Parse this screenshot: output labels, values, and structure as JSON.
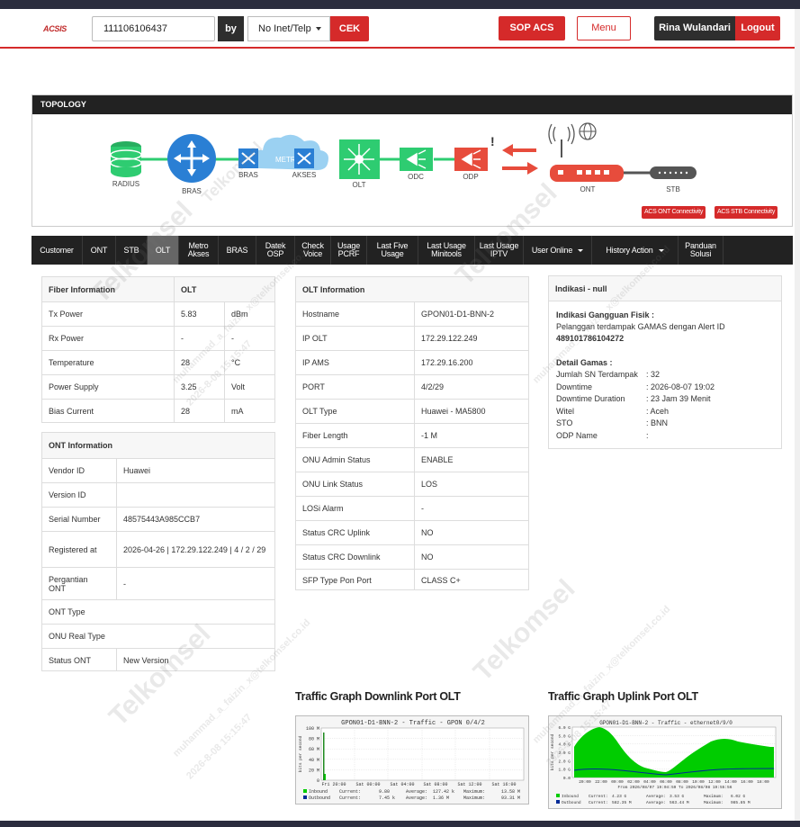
{
  "app": {
    "logo": "ACSIS",
    "search_value": "111106106437",
    "by_label": "by",
    "search_type": "No Inet/Telp",
    "check_label": "CEK",
    "sop_label": "SOP ACS",
    "menu_label": "Menu",
    "user_name": "Rina Wulandari",
    "logout_label": "Logout"
  },
  "topology": {
    "title": "TOPOLOGY",
    "nodes": {
      "radius": "RADIUS",
      "bras1": "BRAS",
      "bras2": "BRAS",
      "metro": "METRO - E",
      "akses": "AKSES",
      "olt": "OLT",
      "odc": "ODC",
      "odp": "ODP",
      "ont": "ONT",
      "stb": "STB"
    },
    "acs_ont_button": "ACS ONT Connectivity",
    "acs_stb_button": "ACS STB Connectivity",
    "colors": {
      "green": "#2ecc71",
      "blue": "#2a7fd4",
      "red": "#e74c3c",
      "dark": "#555555"
    }
  },
  "tabs": [
    {
      "label": "Customer"
    },
    {
      "label": "ONT"
    },
    {
      "label": "STB"
    },
    {
      "label": "OLT",
      "active": true
    },
    {
      "label": "Metro Akses"
    },
    {
      "label": "BRAS"
    },
    {
      "label": "Datek OSP"
    },
    {
      "label": "Check Voice"
    },
    {
      "label": "Usage PCRF"
    },
    {
      "label": "Last Five Usage"
    },
    {
      "label": "Last Usage Minitools"
    },
    {
      "label": "Last Usage IPTV"
    },
    {
      "label": "User Online",
      "dropdown": true
    },
    {
      "label": "History Action",
      "dropdown": true
    },
    {
      "label": "Panduan Solusi"
    }
  ],
  "fiber": {
    "header": [
      "Fiber Information",
      "OLT"
    ],
    "rows": [
      [
        "Tx Power",
        "5.83",
        "dBm"
      ],
      [
        "Rx Power",
        "-",
        "-"
      ],
      [
        "Temperature",
        "28",
        "°C"
      ],
      [
        "Power Supply",
        "3.25",
        "Volt"
      ],
      [
        "Bias Current",
        "28",
        "mA"
      ]
    ]
  },
  "ont_info": {
    "header": "ONT Information",
    "rows": [
      [
        "Vendor ID",
        "Huawei"
      ],
      [
        "Version ID",
        ""
      ],
      [
        "Serial Number",
        "48575443A985CCB7"
      ],
      [
        "Registered at",
        "2026-04-26 | 172.29.122.249 | 4 / 2 / 29"
      ],
      [
        "Pergantian ONT",
        "-"
      ],
      [
        "ONT Type",
        ""
      ],
      [
        "ONU Real Type",
        ""
      ],
      [
        "Status ONT",
        "New Version"
      ]
    ]
  },
  "olt_info": {
    "header": "OLT Information",
    "rows": [
      [
        "Hostname",
        "GPON01-D1-BNN-2"
      ],
      [
        "IP OLT",
        "172.29.122.249"
      ],
      [
        "IP AMS",
        "172.29.16.200"
      ],
      [
        "PORT",
        "4/2/29"
      ],
      [
        "OLT Type",
        "Huawei - MA5800"
      ],
      [
        "Fiber Length",
        "-1 M"
      ],
      [
        "ONU Admin Status",
        "ENABLE"
      ],
      [
        "ONU Link Status",
        "LOS"
      ],
      [
        "LOSi Alarm",
        "-"
      ],
      [
        "Status CRC Uplink",
        "NO"
      ],
      [
        "Status CRC Downlink",
        "NO"
      ],
      [
        "SFP Type Pon Port",
        "CLASS C+"
      ]
    ]
  },
  "indikasi": {
    "header": "Indikasi - null",
    "gangguan_title": "Indikasi Gangguan Fisik :",
    "gangguan_text": "Pelanggan terdampak GAMAS dengan Alert ID",
    "alert_id": "489101786104272",
    "detail_title": "Detail Gamas :",
    "rows": [
      [
        "Jumlah SN Terdampak",
        ": 32"
      ],
      [
        "Downtime",
        ": 2026-08-07 19:02"
      ],
      [
        "Downtime Duration",
        ": 23 Jam 39 Menit"
      ],
      [
        "Witel",
        ": Aceh"
      ],
      [
        "STO",
        ": BNN"
      ],
      [
        "ODP Name",
        ":"
      ]
    ]
  },
  "graphs": {
    "downlink_title": "Traffic Graph Downlink Port OLT",
    "uplink_title": "Traffic Graph Uplink Port OLT",
    "downlink": {
      "header": "GPON01-D1-BNN-2 - Traffic - GPON 0/4/2",
      "ylabel": "bits per second",
      "yticks": [
        "100 M",
        "80 M",
        "60 M",
        "40 M",
        "20 M",
        "0"
      ],
      "xticks": [
        "Fri 20:00",
        "Sat 00:00",
        "Sat 04:00",
        "Sat 08:00",
        "Sat 12:00",
        "Sat 16:00"
      ],
      "legend": [
        [
          "Inbound",
          "Current:",
          "9.80",
          "Average:",
          "127.42 k",
          "Maximum:",
          "13.58 M"
        ],
        [
          "Outbound",
          "Current:",
          "7.45 k",
          "Average:",
          "1.36 M",
          "Maximum:",
          "93.31 M"
        ]
      ]
    },
    "uplink": {
      "header": "GPON01-D1-BNN-2 - Traffic - ethernet0/9/0",
      "ylabel": "bits per second",
      "yticks": [
        "6.0 G",
        "5.0 G",
        "4.0 G",
        "3.0 G",
        "2.0 G",
        "1.0 G",
        "0.0"
      ],
      "xticks": [
        "20:00",
        "22:00",
        "00:00",
        "02:00",
        "04:00",
        "06:00",
        "08:00",
        "10:00",
        "12:00",
        "14:00",
        "16:00",
        "18:00"
      ],
      "footer": "From 2026/08/07 19:04:59 To 2026/08/08 19:55:56",
      "legend": [
        [
          "Inbound",
          "Current:",
          "4.23 G",
          "Average:",
          "3.53 G",
          "Maximum:",
          "6.02 G"
        ],
        [
          "Outbound",
          "Current:",
          "582.35 M",
          "Average:",
          "563.44 M",
          "Maximum:",
          "985.85 M"
        ]
      ]
    }
  },
  "watermark": {
    "brand": "Telkomsel",
    "user_text": "muhammad_a_faizin_x@telkomsel.co.id",
    "date_text": "2026-8-08 15:15:47"
  }
}
